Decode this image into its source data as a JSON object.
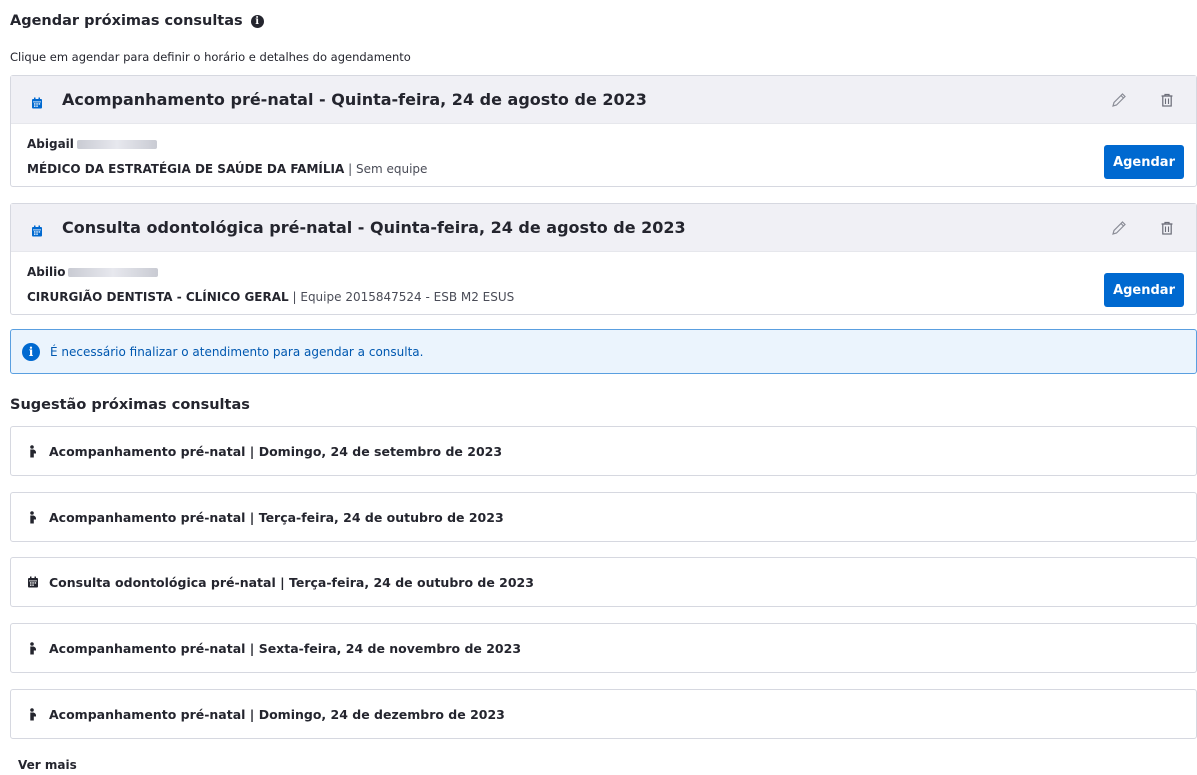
{
  "header": {
    "title": "Agendar próximas consultas",
    "info_glyph": "i",
    "subtitle": "Clique em agendar para definir o horário e detalhes do agendamento"
  },
  "appointments": [
    {
      "title": "Acompanhamento pré-natal - Quinta-feira, 24 de agosto de 2023",
      "professional_name": "Abigail",
      "role": "MÉDICO DA ESTRATÉGIA DE SAÚDE DA FAMÍLIA",
      "team": " | Sem equipe",
      "button_label": "Agendar"
    },
    {
      "title": "Consulta odontológica pré-natal - Quinta-feira, 24 de agosto de 2023",
      "professional_name": "Abilio",
      "role": "CIRURGIÃO DENTISTA - CLÍNICO GERAL",
      "team": " | Equipe 2015847524 - ESB M2 ESUS",
      "button_label": "Agendar"
    }
  ],
  "alert": {
    "icon_glyph": "i",
    "text": "É necessário finalizar o atendimento para agendar a consulta."
  },
  "suggestions": {
    "title": "Sugestão próximas consultas",
    "items": [
      {
        "icon": "pregnant-icon",
        "text": "Acompanhamento pré-natal | Domingo, 24 de setembro de 2023"
      },
      {
        "icon": "pregnant-icon",
        "text": "Acompanhamento pré-natal | Terça-feira, 24 de outubro de 2023"
      },
      {
        "icon": "calendar-icon",
        "text": "Consulta odontológica pré-natal | Terça-feira, 24 de outubro de 2023"
      },
      {
        "icon": "pregnant-icon",
        "text": "Acompanhamento pré-natal | Sexta-feira, 24 de novembro de 2023"
      },
      {
        "icon": "pregnant-icon",
        "text": "Acompanhamento pré-natal | Domingo, 24 de dezembro de 2023"
      }
    ],
    "see_more_label": "Ver mais"
  },
  "colors": {
    "primary": "#0069d0",
    "card_header_bg": "#f0f0f5",
    "alert_bg": "#ebf4fd",
    "alert_border": "#5a9fe0"
  }
}
